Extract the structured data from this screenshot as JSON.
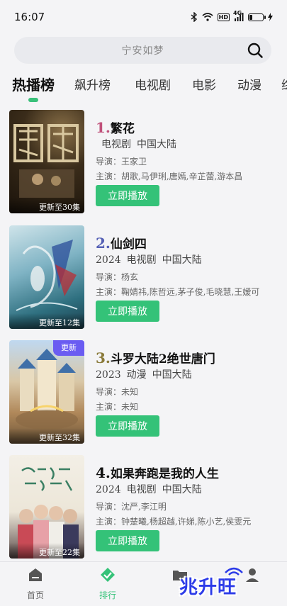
{
  "status_bar": {
    "time": "16:07",
    "network": "4G",
    "hd": "HD"
  },
  "search": {
    "placeholder": "宁安如梦"
  },
  "tabs": [
    {
      "label": "热播榜",
      "active": true
    },
    {
      "label": "飙升榜"
    },
    {
      "label": "电视剧"
    },
    {
      "label": "电影"
    },
    {
      "label": "动漫"
    },
    {
      "label": "综"
    }
  ],
  "items": [
    {
      "rank": "1.",
      "title": "繁花",
      "year": "",
      "type": "电视剧",
      "region": "中国大陆",
      "director": "导演：王家卫",
      "cast": "主演：胡歌,马伊琍,唐嫣,辛芷蕾,游本昌",
      "update": "更新至30集",
      "badge": "",
      "button": "立即播放",
      "rank_color": "#c0507a"
    },
    {
      "rank": "2.",
      "title": "仙剑四",
      "year": "2024",
      "type": "电视剧",
      "region": "中国大陆",
      "director": "导演：杨玄",
      "cast": "主演：鞠婧祎,陈哲远,茅子俊,毛晓慧,王嫒可",
      "update": "更新至12集",
      "badge": "",
      "button": "立即播放",
      "rank_color": "#5560b5"
    },
    {
      "rank": "3.",
      "title": "斗罗大陆2绝世唐门",
      "year": "2023",
      "type": "动漫",
      "region": "中国大陆",
      "director": "导演：未知",
      "cast": "主演：未知",
      "update": "更新至32集",
      "badge": "更新",
      "button": "立即播放",
      "rank_color": "#8a7a3a"
    },
    {
      "rank": "4.",
      "title": "如果奔跑是我的人生",
      "year": "2024",
      "type": "电视剧",
      "region": "中国大陆",
      "director": "导演：沈严,李江明",
      "cast": "主演：钟楚曦,杨超越,许娣,陈小艺,侯雯元",
      "update": "更新至22集",
      "badge": "",
      "button": "立即播放",
      "rank_color": "#111111"
    }
  ],
  "bottom_nav": [
    {
      "label": "首页",
      "icon": "home-icon"
    },
    {
      "label": "排行",
      "icon": "ranking-icon",
      "active": true
    },
    {
      "label": "",
      "icon": "folder-icon"
    },
    {
      "label": "",
      "icon": "user-icon"
    }
  ],
  "watermark": "兆升旺",
  "colors": {
    "accent": "#34c278",
    "badge": "#6a5cf2"
  }
}
